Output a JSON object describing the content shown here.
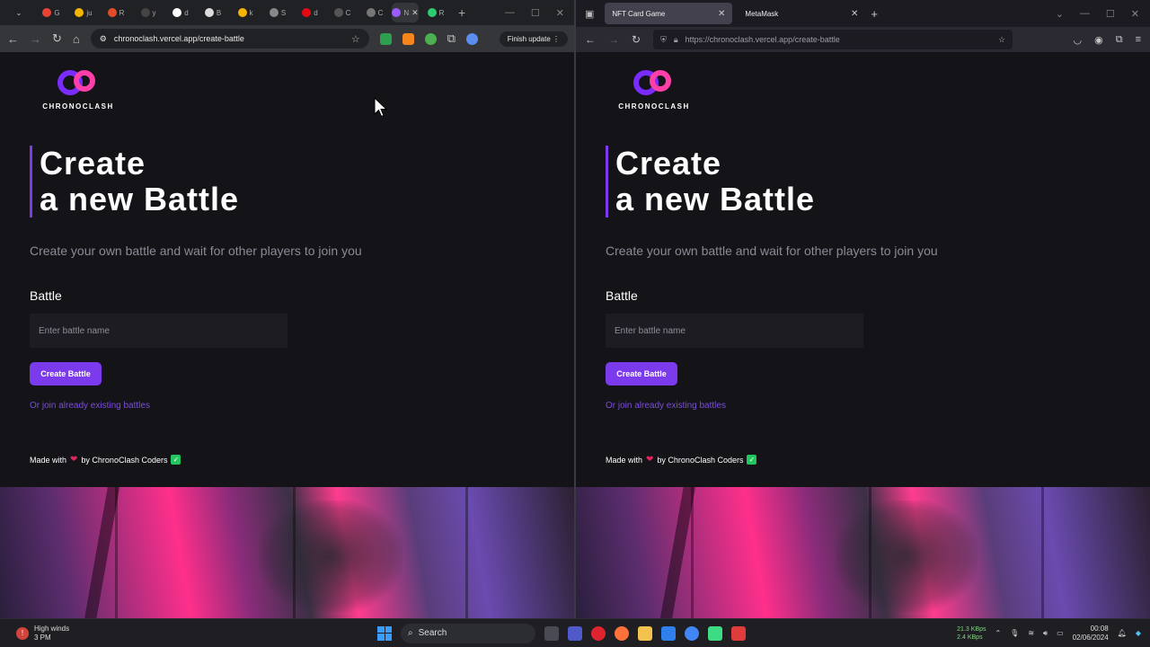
{
  "left_browser": {
    "tab_labels": [
      "G",
      "ju",
      "R",
      "y",
      "d",
      "B",
      "k",
      "S",
      "d",
      "C",
      "C",
      "N",
      "R"
    ],
    "address": "chronoclash.vercel.app/create-battle",
    "update_button": "Finish update"
  },
  "right_browser": {
    "tabs": [
      {
        "label": "NFT Card Game"
      },
      {
        "label": "MetaMask"
      }
    ],
    "address": "https://chronoclash.vercel.app/create-battle"
  },
  "page": {
    "logo_text": "CHRONOCLASH",
    "title_line1": "Create",
    "title_line2": "a new Battle",
    "subtitle": "Create your own battle and wait for other players to join you",
    "field_label": "Battle",
    "input_placeholder": "Enter battle name",
    "create_button": "Create Battle",
    "join_link": "Or join already existing battles",
    "footer_prefix": "Made with",
    "footer_suffix": "by ChronoClash Coders"
  },
  "taskbar": {
    "weather_line1": "High winds",
    "weather_line2": "3 PM",
    "search_label": "Search",
    "net_up": "21.3 KBps",
    "net_down": "2.4 KBps",
    "time": "00:08",
    "date": "02/06/2024"
  },
  "colors": {
    "accent": "#7c3aed",
    "link": "#7c4ddb",
    "background": "#131318"
  }
}
